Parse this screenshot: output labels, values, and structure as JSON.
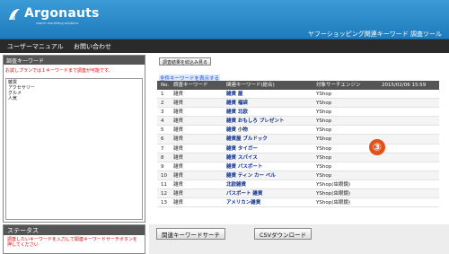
{
  "header": {
    "brand": "Argonauts",
    "brand_sub": "search marketing solutions",
    "title": "ヤフーショッピング関連キーワード 調査ツール",
    "accent": "#2a8ccc"
  },
  "menu": {
    "items": [
      "ユーザーマニュアル",
      "お問い合わせ"
    ]
  },
  "left_panel": {
    "heading": "調査キーワード",
    "note": "お試しプランでは１キーワードまで調査が可能です。",
    "keywords": [
      "雑貨",
      "アクセサリー",
      "グルメ",
      "人気"
    ]
  },
  "status": {
    "heading": "ステータス",
    "text": "調査したいキーワードを入力して関連キーワードサーチボタンを押してください"
  },
  "toolbar": {
    "filter_button": "調査結果を絞込み見る",
    "result_link": "全件キーワードを表示する"
  },
  "table": {
    "headers": [
      "No.",
      "調査キーワード",
      "関連キーワード(総合)",
      "対象サーチエンジン",
      "2015/02/06 15:59"
    ],
    "rows": [
      [
        "1",
        "雑貨",
        "雑貨 屋",
        "YShop"
      ],
      [
        "2",
        "雑貨",
        "雑貨 福袋",
        "YShop"
      ],
      [
        "3",
        "雑貨",
        "雑貨 北欧",
        "YShop"
      ],
      [
        "4",
        "雑貨",
        "雑貨 おもしろ プレゼント",
        "YShop"
      ],
      [
        "5",
        "雑貨",
        "雑貨 小物",
        "YShop"
      ],
      [
        "6",
        "雑貨",
        "雑貨屋 ブルドック",
        "YShop"
      ],
      [
        "7",
        "雑貨",
        "雑貨 タイガー",
        "YShop"
      ],
      [
        "8",
        "雑貨",
        "雑貨 スパイス",
        "YShop"
      ],
      [
        "9",
        "雑貨",
        "雑貨 パスポート",
        "YShop"
      ],
      [
        "10",
        "雑貨",
        "雑貨 ティン カー ベル",
        "YShop"
      ],
      [
        "11",
        "雑貨",
        "北欧雑貨",
        "YShop(虫眼鏡)"
      ],
      [
        "12",
        "雑貨",
        "パスポート 雑貨",
        "YShop(虫眼鏡)"
      ],
      [
        "13",
        "雑貨",
        "アメリカン雑貨",
        "YShop(虫眼鏡)"
      ]
    ]
  },
  "marker": "③",
  "bottom": {
    "search_button": "関連キーワードサーチ",
    "csv_button": "CSVダウンロード"
  }
}
